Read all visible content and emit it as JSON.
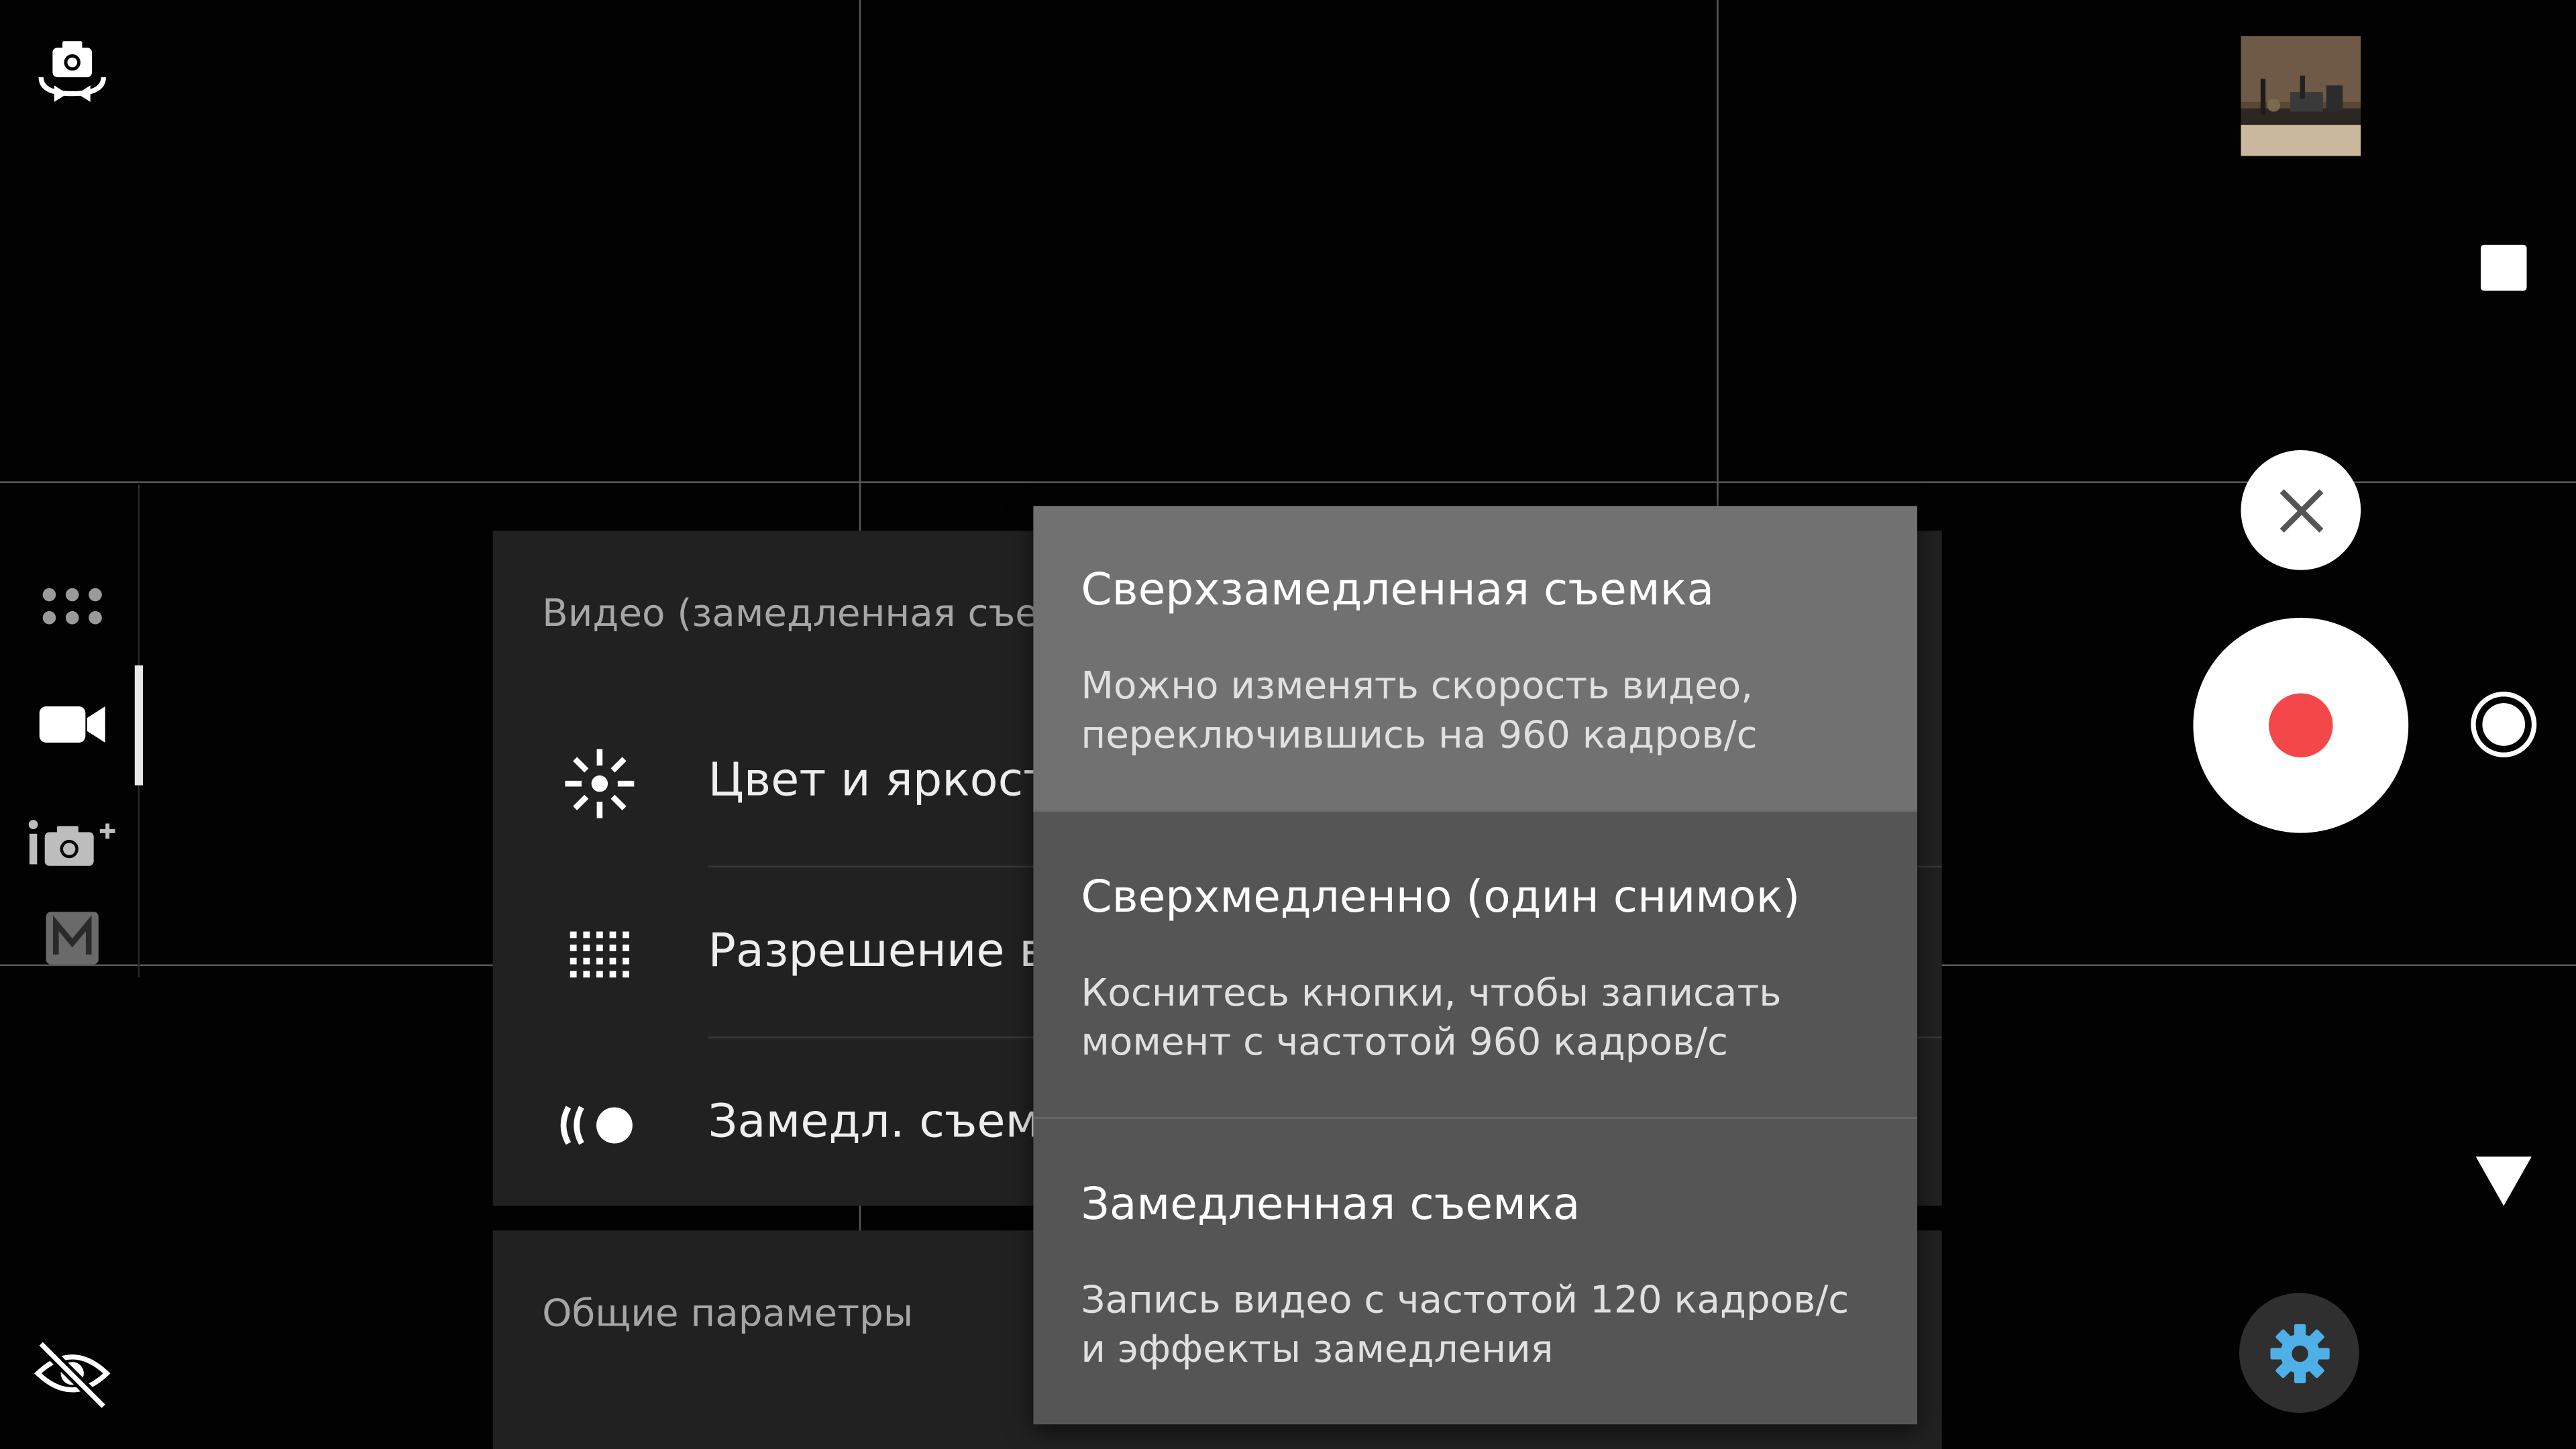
{
  "panel": {
    "section_title": "Видео (замедленная съемка)",
    "rows": [
      {
        "label": "Цвет и яркость",
        "icon": "brightness-icon"
      },
      {
        "label": "Разрешение видео",
        "icon": "resolution-grid-icon"
      },
      {
        "label": "Замедл. съемка",
        "icon": "slow-motion-icon"
      }
    ],
    "general_title": "Общие параметры"
  },
  "dropdown": {
    "options": [
      {
        "title": "Сверхзамедленная съемка",
        "desc_line1": "Можно изменять скорость видео,",
        "desc_line2": "переключившись на 960 кадров/с",
        "selected": true
      },
      {
        "title": "Сверхмедленно (один снимок)",
        "desc_line1": "Коснитесь кнопки, чтобы записать",
        "desc_line2": "момент с частотой 960 кадров/с",
        "selected": false
      },
      {
        "title": "Замедленная съемка",
        "desc_line1": "Запись видео с частотой 120 кадров/с",
        "desc_line2": "и эффекты замедления",
        "selected": false
      }
    ]
  },
  "colors": {
    "record_dot": "#f4474a",
    "settings_gear": "#4fb0e8",
    "panel_bg": "#212121",
    "dropdown_bg": "#555555",
    "dropdown_selected_bg": "#717171"
  },
  "icons": {
    "left_rail": [
      "switch-camera-icon",
      "apps-grid-icon",
      "video-camera-icon",
      "photo-plus-icon",
      "manual-mode-icon",
      "flash-off-icon"
    ],
    "right_rail": [
      "gallery-thumbnail",
      "stop-icon",
      "close-icon",
      "record-button",
      "shutter-mode-icon",
      "dropdown-arrow-icon",
      "settings-gear-icon"
    ]
  }
}
